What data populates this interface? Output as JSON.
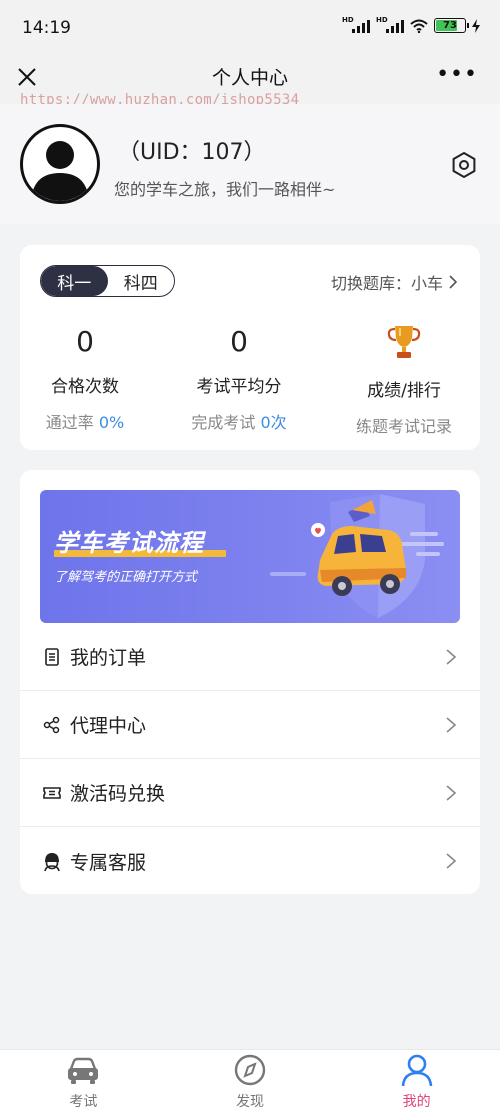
{
  "status_bar": {
    "time": "14:19",
    "hd1": "HD",
    "hd2": "HD",
    "battery": "73"
  },
  "nav": {
    "title": "个人中心",
    "more": "•••"
  },
  "watermark": "https://www.huzhan.com/ishop5534",
  "profile": {
    "uid": "（UID：107）",
    "slogan": "您的学车之旅，我们一路相伴~"
  },
  "stats": {
    "subject_tabs": [
      "科一",
      "科四"
    ],
    "active_subject": "科一",
    "bank_switch": "切换题库：小车",
    "pass_count": {
      "value": "0",
      "label": "合格次数",
      "sub_prefix": "通过率",
      "sub_value": "0%"
    },
    "avg_score": {
      "value": "0",
      "label": "考试平均分",
      "sub_prefix": "完成考试",
      "sub_value": "0次"
    },
    "ranking": {
      "icon": "trophy-icon",
      "label": "成绩/排行",
      "sub": "练题考试记录"
    }
  },
  "banner": {
    "title": "学车考试流程",
    "subtitle": "了解驾考的正确打开方式"
  },
  "menu": [
    {
      "label": "我的订单",
      "icon": "order-list-icon"
    },
    {
      "label": "代理中心",
      "icon": "share-nodes-icon"
    },
    {
      "label": "激活码兑换",
      "icon": "ticket-icon"
    },
    {
      "label": "专属客服",
      "icon": "customer-service-icon"
    }
  ],
  "tabs": [
    {
      "label": "考试",
      "icon": "car-icon"
    },
    {
      "label": "发现",
      "icon": "compass-icon"
    },
    {
      "label": "我的",
      "icon": "user-icon"
    }
  ],
  "colors": {
    "accent_blue": "#3d8de0",
    "active_tab": "#e0447e",
    "toggle_dark": "#2e3144",
    "banner": "#7579ec"
  }
}
